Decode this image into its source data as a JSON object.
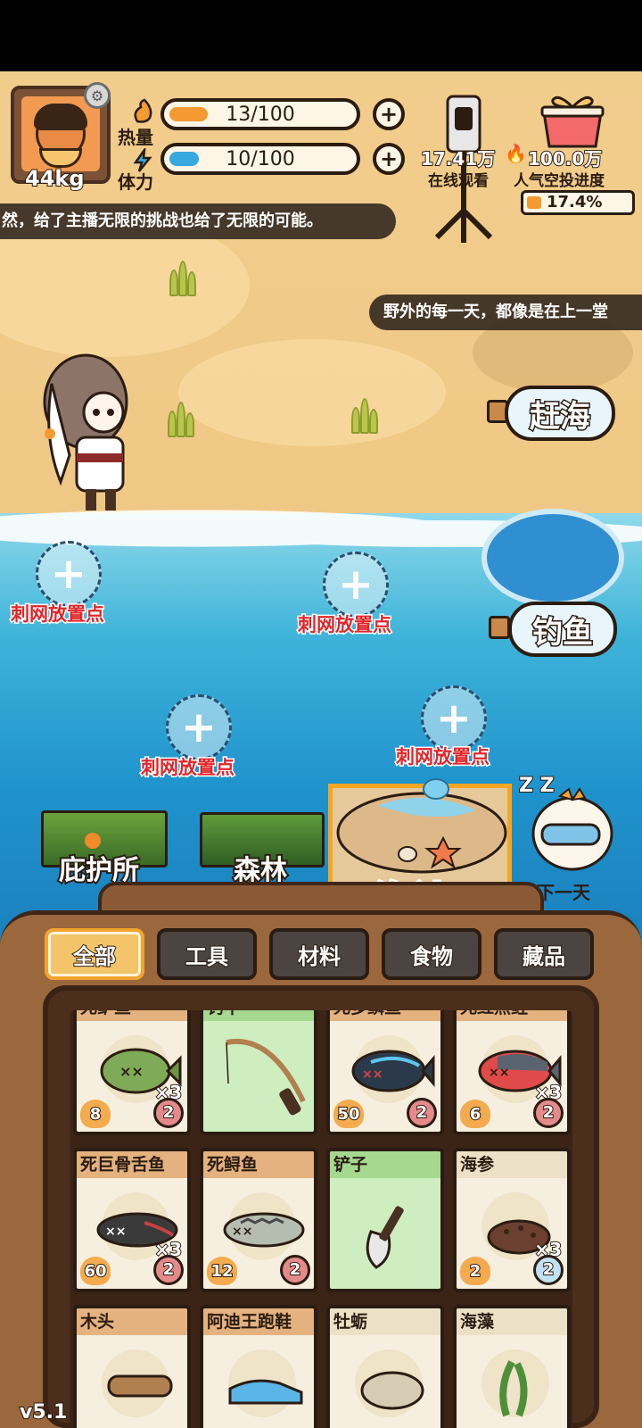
{
  "player": {
    "weight": "44kg"
  },
  "stats": {
    "heat": {
      "label": "热量",
      "value": "13/100",
      "fraction": 0.13,
      "color": "#f39a31"
    },
    "stamina": {
      "label": "体力",
      "value": "10/100",
      "fraction": 0.1,
      "color": "#36a9e1"
    }
  },
  "live": {
    "viewers": "17.41万",
    "viewers_caption": "在线观看",
    "popularity": "100.0万",
    "popularity_caption": "人气空投进度",
    "airdrop_progress": "17.4%",
    "airdrop_fraction": 0.174
  },
  "tickers": [
    "然，给了主播无限的挑战也给了无限的可能。",
    "野外的每一天，都像是在上一堂"
  ],
  "actions": {
    "tide": "赶海",
    "fishing": "钓鱼"
  },
  "nets": [
    {
      "label": "刺网放置点"
    },
    {
      "label": "刺网放置点"
    },
    {
      "label": "刺网放置点"
    },
    {
      "label": "刺网放置点"
    }
  ],
  "locations": {
    "shelter": "庇护所",
    "forest": "森林",
    "seaside": "海边",
    "next_day": "下一天",
    "zzz": "Z Z"
  },
  "tabs": [
    "全部",
    "工具",
    "材料",
    "食物",
    "藏品"
  ],
  "active_tab": "全部",
  "inventory": [
    {
      "name": "死鲈鱼",
      "qty": "×3",
      "heat": "8",
      "weight": "2",
      "style": "brown",
      "icon": "fish-green-icon"
    },
    {
      "name": "钓竿",
      "qty": "",
      "heat": "",
      "weight": "",
      "style": "green",
      "icon": "fishing-rod-icon"
    },
    {
      "name": "死多鳞鱼",
      "qty": "",
      "heat": "50",
      "weight": "2",
      "style": "brown",
      "icon": "fish-blue-icon"
    },
    {
      "name": "死红点鲑",
      "qty": "×3",
      "heat": "6",
      "weight": "2",
      "style": "brown",
      "icon": "fish-red-icon"
    },
    {
      "name": "死巨骨舌鱼",
      "qty": "×3",
      "heat": "60",
      "weight": "2",
      "style": "brown",
      "icon": "fish-dark-icon"
    },
    {
      "name": "死鲟鱼",
      "qty": "",
      "heat": "12",
      "weight": "2",
      "style": "brown",
      "icon": "fish-gray-icon"
    },
    {
      "name": "铲子",
      "qty": "",
      "heat": "",
      "weight": "",
      "style": "green",
      "icon": "shovel-icon"
    },
    {
      "name": "海参",
      "qty": "×3",
      "heat": "2",
      "weight": "2",
      "style": "white",
      "icon": "sea-cucumber-icon"
    },
    {
      "name": "木头",
      "qty": "",
      "heat": "",
      "weight": "",
      "style": "brown",
      "icon": "wood-icon"
    },
    {
      "name": "阿迪王跑鞋",
      "qty": "",
      "heat": "",
      "weight": "",
      "style": "brown",
      "icon": "shoe-icon"
    },
    {
      "name": "牡蛎",
      "qty": "",
      "heat": "",
      "weight": "",
      "style": "white",
      "icon": "oyster-icon"
    },
    {
      "name": "海藻",
      "qty": "",
      "heat": "",
      "weight": "",
      "style": "white",
      "icon": "seaweed-icon"
    }
  ],
  "version": "v5.1"
}
